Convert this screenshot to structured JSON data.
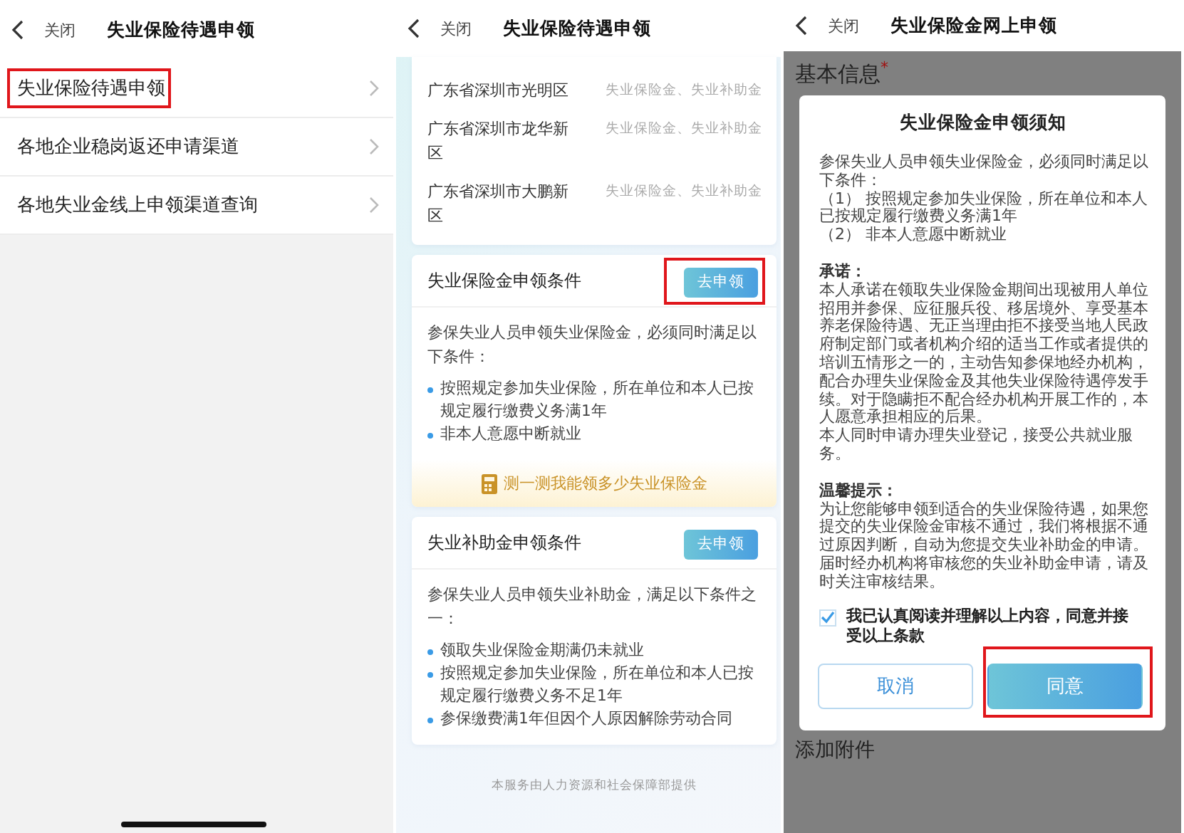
{
  "screens": [
    {
      "kind": "menu",
      "header": {
        "close": "关闭",
        "title": "失业保险待遇申领"
      },
      "items": [
        {
          "label": "失业保险待遇申领",
          "highlighted": true
        },
        {
          "label": "各地企业稳岗返还申请渠道",
          "highlighted": false
        },
        {
          "label": "各地失业金线上申领渠道查询",
          "highlighted": false
        }
      ]
    },
    {
      "kind": "detail",
      "header": {
        "close": "关闭",
        "title": "失业保险待遇申领"
      },
      "regions": [
        {
          "name": "广东省深圳市光明区",
          "value": "失业保险金、失业补助金"
        },
        {
          "name": "广东省深圳市龙华新区",
          "value": "失业保险金、失业补助金"
        },
        {
          "name": "广东省深圳市大鹏新区",
          "value": "失业保险金、失业补助金"
        }
      ],
      "cards": [
        {
          "title": "失业保险金申领条件",
          "button": {
            "label": "去申领",
            "highlighted": true
          },
          "intro": "参保失业人员申领失业保险金，必须同时满足以下条件：",
          "bullets": [
            "按照规定参加失业保险，所在单位和本人已按规定履行缴费义务满1年",
            "非本人意愿中断就业"
          ],
          "calculator": "测一测我能领多少失业保险金"
        },
        {
          "title": "失业补助金申领条件",
          "button": {
            "label": "去申领",
            "highlighted": false
          },
          "intro": "参保失业人员申领失业补助金，满足以下条件之一：",
          "bullets": [
            "领取失业保险金期满仍未就业",
            "按照规定参加失业保险，所在单位和本人已按规定履行缴费义务不足1年",
            "参保缴费满1年但因个人原因解除劳动合同"
          ]
        }
      ],
      "footer": "本服务由人力资源和社会保障部提供"
    },
    {
      "kind": "form",
      "header": {
        "close": "关闭",
        "title": "失业保险金网上申领"
      },
      "section_label": "基本信息",
      "required_mark": "*",
      "modal": {
        "title": "失业保险金申领须知",
        "sections": [
          {
            "lines": [
              "参保失业人员申领失业保险金，必须同时满足以下条件：",
              "（1） 按照规定参加失业保险，所在单位和本人已按规定履行缴费义务满1年",
              "（2） 非本人意愿中断就业"
            ]
          },
          {
            "heading": "承诺：",
            "lines": [
              "本人承诺在领取失业保险金期间出现被用人单位招用并参保、应征服兵役、移居境外、享受基本养老保险待遇、无正当理由拒不接受当地人民政府制定部门或者机构介绍的适当工作或者提供的培训五情形之一的，主动告知参保地经办机构，配合办理失业保险金及其他失业保险待遇停发手续。对于隐瞒拒不配合经办机构开展工作的，本人愿意承担相应的后果。",
              "本人同时申请办理失业登记，接受公共就业服务。"
            ]
          },
          {
            "heading": "温馨提示：",
            "lines": [
              "为让您能够申领到适合的失业保险待遇，如果您提交的失业保险金审核不通过，我们将根据不通过原因判断，自动为您提交失业补助金的申请。届时经办机构将审核您的失业补助金申请，请及时关注审核结果。"
            ]
          }
        ],
        "agreement": {
          "checked": true,
          "text": "我已认真阅读并理解以上内容，同意并接受以上条款"
        },
        "buttons": [
          {
            "label": "取消",
            "kind": "secondary",
            "highlighted": false
          },
          {
            "label": "同意",
            "kind": "primary",
            "highlighted": true
          }
        ]
      },
      "next_section_label": "添加附件"
    }
  ]
}
